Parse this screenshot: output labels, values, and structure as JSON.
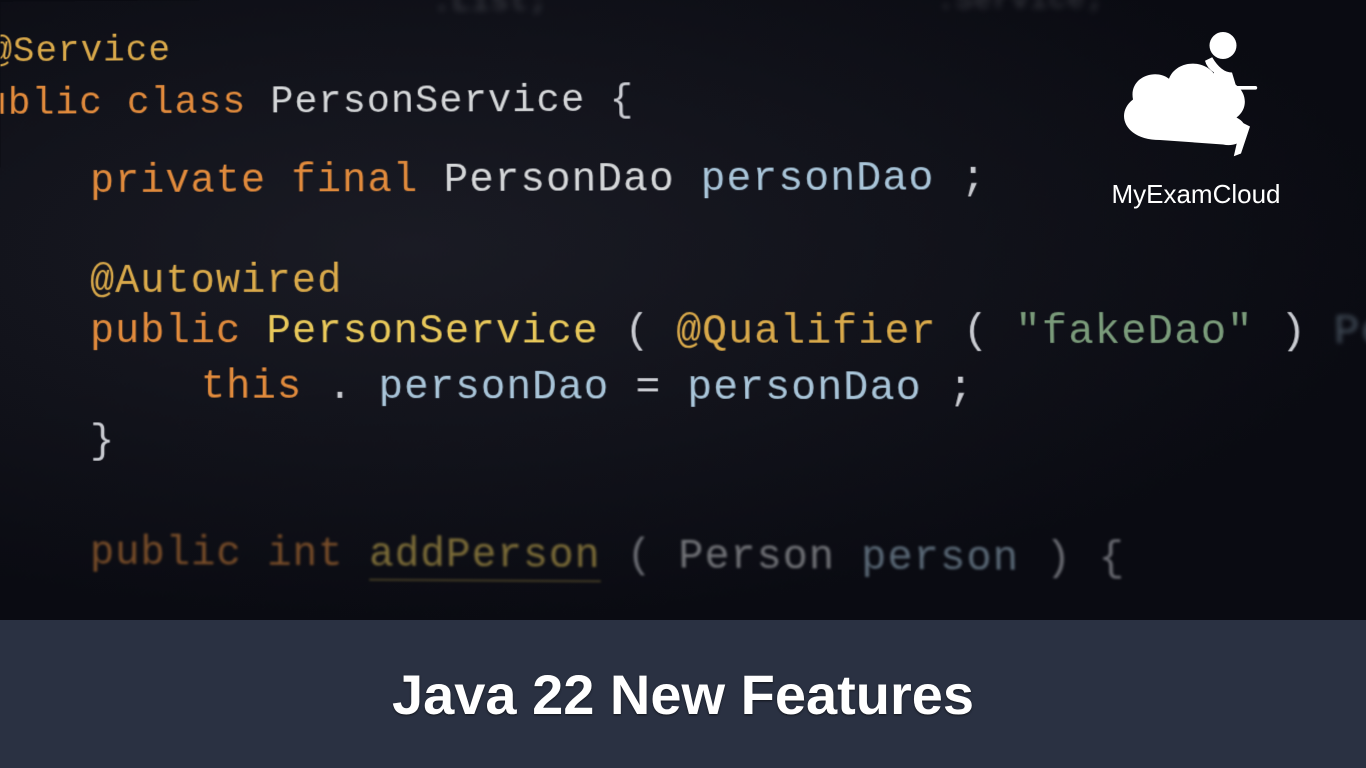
{
  "logo": {
    "brand": "MyExamCloud"
  },
  "footer": {
    "title": "Java 22 New Features"
  },
  "code": {
    "top_frag1": ".List;",
    "top_frag2": ".Service;",
    "anno_service": "@Service",
    "kw_public": "public",
    "kw_class": "class",
    "kw_private": "private",
    "kw_final": "final",
    "kw_int": "int",
    "type_personservice": "PersonService",
    "type_persondao": "PersonDao",
    "type_person": "Person",
    "id_persondao": "personDao",
    "id_person": "person",
    "anno_autowired": "@Autowired",
    "ctor_personservice": "PersonService",
    "anno_qualifier": "@Qualifier",
    "str_fakedao": "\"fakeDao\"",
    "this": "this",
    "eq": "=",
    "semi": ";",
    "lbrace": "{",
    "rbrace": "}",
    "lparen": "(",
    "rparen": ")",
    "dot": ".",
    "method_addperson": "addPerson",
    "blurred_tail": "PersonDao personDao"
  }
}
